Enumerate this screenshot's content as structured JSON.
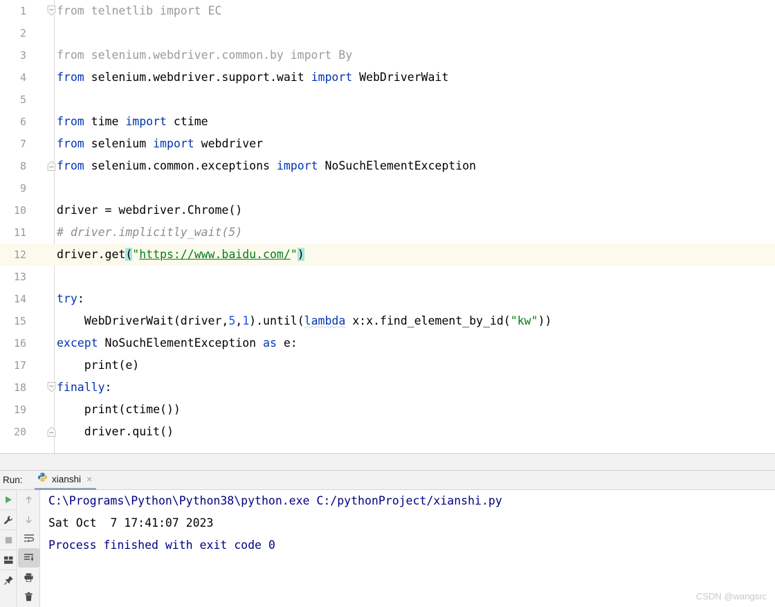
{
  "editor": {
    "lines": [
      {
        "n": "1",
        "fold": "start",
        "current": false,
        "tokens": [
          {
            "t": "from telnetlib import EC",
            "c": "gray"
          }
        ]
      },
      {
        "n": "2",
        "fold": "none",
        "current": false,
        "tokens": []
      },
      {
        "n": "3",
        "fold": "none",
        "current": false,
        "tokens": [
          {
            "t": "from selenium.webdriver.common.by import By",
            "c": "gray"
          }
        ]
      },
      {
        "n": "4",
        "fold": "none",
        "current": false,
        "tokens": [
          {
            "t": "from",
            "c": "kw"
          },
          {
            "t": " selenium.webdriver.support.wait ",
            "c": "plain"
          },
          {
            "t": "import",
            "c": "kw"
          },
          {
            "t": " WebDriverWait",
            "c": "plain"
          }
        ]
      },
      {
        "n": "5",
        "fold": "none",
        "current": false,
        "tokens": []
      },
      {
        "n": "6",
        "fold": "none",
        "current": false,
        "tokens": [
          {
            "t": "from",
            "c": "kw"
          },
          {
            "t": " time ",
            "c": "plain"
          },
          {
            "t": "import",
            "c": "kw"
          },
          {
            "t": " ctime",
            "c": "plain"
          }
        ]
      },
      {
        "n": "7",
        "fold": "none",
        "current": false,
        "tokens": [
          {
            "t": "from",
            "c": "kw"
          },
          {
            "t": " selenium ",
            "c": "plain"
          },
          {
            "t": "import",
            "c": "kw"
          },
          {
            "t": " webdriver",
            "c": "plain"
          }
        ]
      },
      {
        "n": "8",
        "fold": "end",
        "current": false,
        "tokens": [
          {
            "t": "from",
            "c": "kw"
          },
          {
            "t": " selenium.common.exceptions ",
            "c": "plain"
          },
          {
            "t": "import",
            "c": "kw"
          },
          {
            "t": " NoSuchElementException",
            "c": "plain"
          }
        ]
      },
      {
        "n": "9",
        "fold": "none",
        "current": false,
        "tokens": []
      },
      {
        "n": "10",
        "fold": "none",
        "current": false,
        "tokens": [
          {
            "t": "driver = webdriver.Chrome()",
            "c": "plain"
          }
        ]
      },
      {
        "n": "11",
        "fold": "none",
        "current": false,
        "tokens": [
          {
            "t": "# driver.implicitly_wait(5)",
            "c": "cmt"
          }
        ]
      },
      {
        "n": "12",
        "fold": "none",
        "current": true,
        "tokens": [
          {
            "t": "driver.get",
            "c": "plain"
          },
          {
            "t": "(",
            "c": "brk"
          },
          {
            "t": "\"",
            "c": "str"
          },
          {
            "t": "https://www.baidu.com/",
            "c": "url"
          },
          {
            "t": "\"",
            "c": "str"
          },
          {
            "t": ")",
            "c": "brk"
          }
        ]
      },
      {
        "n": "13",
        "fold": "none",
        "current": false,
        "tokens": []
      },
      {
        "n": "14",
        "fold": "none",
        "current": false,
        "tokens": [
          {
            "t": "try",
            "c": "kw"
          },
          {
            "t": ":",
            "c": "plain"
          }
        ]
      },
      {
        "n": "15",
        "fold": "none",
        "current": false,
        "tokens": [
          {
            "t": "    WebDriverWait(driver,",
            "c": "plain"
          },
          {
            "t": "5",
            "c": "num"
          },
          {
            "t": ",",
            "c": "plain"
          },
          {
            "t": "1",
            "c": "num"
          },
          {
            "t": ").until(",
            "c": "plain"
          },
          {
            "t": "lambda",
            "c": "kw-squig"
          },
          {
            "t": " x:x.find_element_by_id(",
            "c": "plain"
          },
          {
            "t": "\"kw\"",
            "c": "str"
          },
          {
            "t": "))",
            "c": "plain"
          }
        ]
      },
      {
        "n": "16",
        "fold": "none",
        "current": false,
        "tokens": [
          {
            "t": "except",
            "c": "kw"
          },
          {
            "t": " NoSuchElementException ",
            "c": "plain"
          },
          {
            "t": "as",
            "c": "kw"
          },
          {
            "t": " e:",
            "c": "plain"
          }
        ]
      },
      {
        "n": "17",
        "fold": "none",
        "current": false,
        "tokens": [
          {
            "t": "    print(e)",
            "c": "plain"
          }
        ]
      },
      {
        "n": "18",
        "fold": "start",
        "current": false,
        "tokens": [
          {
            "t": "finally",
            "c": "kw"
          },
          {
            "t": ":",
            "c": "plain"
          }
        ]
      },
      {
        "n": "19",
        "fold": "none",
        "current": false,
        "tokens": [
          {
            "t": "    print(ctime())",
            "c": "plain"
          }
        ]
      },
      {
        "n": "20",
        "fold": "end",
        "current": false,
        "tokens": [
          {
            "t": "    driver.quit()",
            "c": "plain"
          }
        ]
      }
    ]
  },
  "run_panel": {
    "run_label": "Run:",
    "tab_name": "xianshi",
    "tab_close": "×",
    "tab_icon": "python-icon",
    "toolbar_left": [
      {
        "name": "rerun-button",
        "icon": "play-icon"
      },
      {
        "name": "debug-settings-button",
        "icon": "wrench-icon"
      },
      {
        "name": "stop-button",
        "icon": "stop-icon"
      },
      {
        "name": "layout-button",
        "icon": "layout-icon"
      },
      {
        "name": "pin-tab-button",
        "icon": "pin-icon"
      }
    ],
    "toolbar_right": [
      {
        "name": "up-the-stack-trace-button",
        "icon": "arrow-up-icon",
        "active": false
      },
      {
        "name": "down-the-stack-trace-button",
        "icon": "arrow-down-icon",
        "active": false
      },
      {
        "name": "soft-wrap-button",
        "icon": "soft-wrap-icon",
        "active": false
      },
      {
        "name": "scroll-to-end-button",
        "icon": "scroll-to-end-icon",
        "active": true
      },
      {
        "name": "print-button",
        "icon": "printer-icon",
        "active": false
      },
      {
        "name": "clear-all-button",
        "icon": "trash-icon",
        "active": false
      }
    ],
    "output": [
      {
        "text": "C:\\Programs\\Python\\Python38\\python.exe C:/pythonProject/xianshi.py",
        "c": "out-cmd"
      },
      {
        "text": "Sat Oct  7 17:41:07 2023",
        "c": "out-text"
      },
      {
        "text": "",
        "c": "out-text"
      },
      {
        "text": "Process finished with exit code 0",
        "c": "out-done"
      }
    ]
  },
  "watermark": "CSDN @wangsrc",
  "colors": {
    "keyword": "#0033b3",
    "string": "#067d17",
    "number": "#1750eb",
    "comment": "#8c8c8c",
    "grayed": "#9a9a9a",
    "bracket_highlight": "#a9e7e0",
    "current_line": "#fcfaed",
    "console_cmd": "#000080",
    "tab_underline": "#93a2bd",
    "play_green": "#59a869"
  }
}
